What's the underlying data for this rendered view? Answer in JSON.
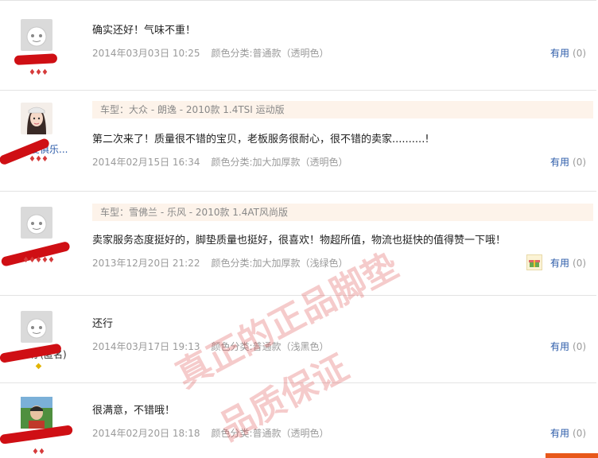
{
  "reviews": [
    {
      "content": "确实还好！气味不重！",
      "date": "2014年03月03日 10:25",
      "sku": "颜色分类:普通款（透明色）",
      "username": "",
      "hearts": "♦♦♦",
      "useful_label": "有用",
      "useful_count": "(0)"
    },
    {
      "car": "车型：大众 - 朗逸 - 2010款 1.4TSI 运动版",
      "content": "第二次来了！质量很不错的宝贝，老板服务很耐心，很不错的卖家..........!",
      "date": "2014年02月15日 16:34",
      "sku": "颜色分类:加大加厚款（透明色）",
      "username": "爱俱乐...",
      "hearts": "♦♦♦",
      "useful_label": "有用",
      "useful_count": "(0)"
    },
    {
      "car": "车型：雪佛兰 - 乐风 - 2010款 1.4AT风尚版",
      "content": "卖家服务态度挺好的，脚垫质量也挺好，很喜欢！物超所值，物流也挺快的值得赞一下哦！",
      "date": "2013年12月20日 21:22",
      "sku": "颜色分类:加大加厚款（浅绿色）",
      "username": "",
      "hearts": "♦♦♦♦♦",
      "useful_label": "有用",
      "useful_count": "(0)"
    },
    {
      "content": "还行",
      "date": "2014年03月17日 19:13",
      "sku": "颜色分类:普通款（浅黑色）",
      "username": "**仔(匿名)",
      "hearts": "◆",
      "useful_label": "有用",
      "useful_count": "(0)"
    },
    {
      "content": "很满意，不错哦！",
      "date": "2014年02月20日 18:18",
      "sku": "颜色分类:普通款（透明色）",
      "username": "",
      "hearts": "♦♦",
      "useful_label": "有用",
      "useful_count": "(0)"
    }
  ],
  "watermark": {
    "line1": "真正的正品脚垫",
    "line2": "品质保证"
  },
  "colors": {
    "link": "#2a5aa8",
    "meta": "#9a9a9a",
    "car_bg": "#fdf3ea",
    "redaction": "#cf0f14",
    "watermark": "#dc4646"
  }
}
